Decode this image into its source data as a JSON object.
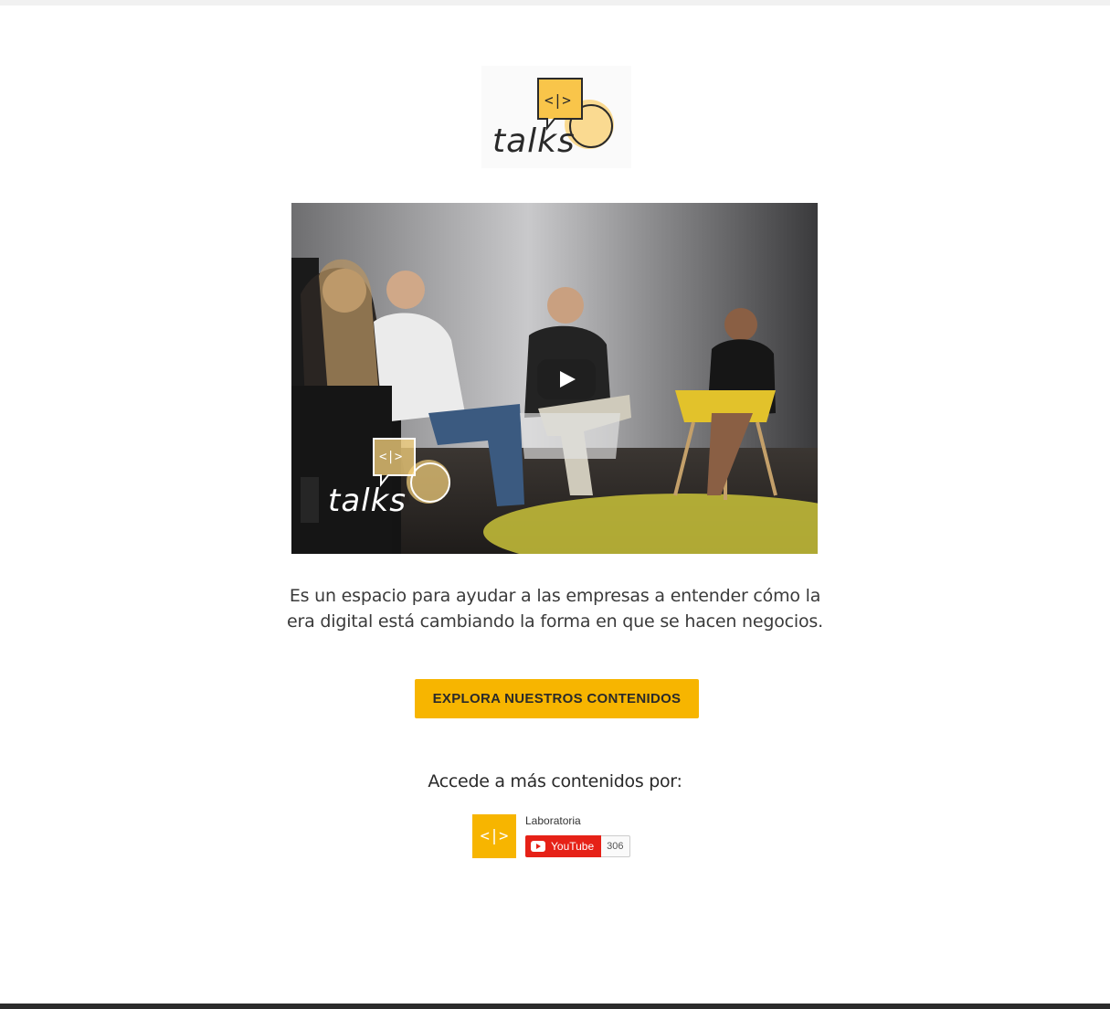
{
  "logo": {
    "brand": "talks",
    "glyph": "<|>"
  },
  "video": {
    "overlay_brand": "talks",
    "overlay_glyph": "<|>"
  },
  "description": "Es un espacio para ayudar a las empresas a entender cómo la era digital está cambiando la forma en que se hacen negocios.",
  "cta": {
    "label": "EXPLORA NUESTROS CONTENIDOS"
  },
  "social": {
    "heading": "Accede a más contenidos por:",
    "channel_name": "Laboratoria",
    "channel_avatar_glyph": "<|>",
    "subscribe_label": "YouTube",
    "subscriber_count": "306"
  },
  "colors": {
    "accent": "#f7b500",
    "youtube_red": "#e62117"
  }
}
